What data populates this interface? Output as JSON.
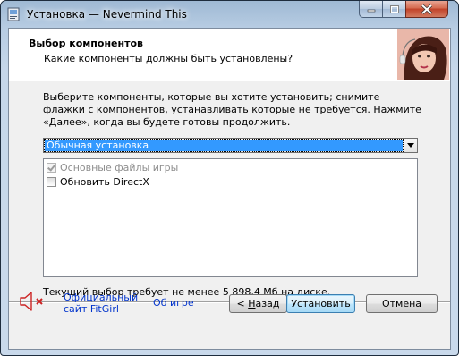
{
  "window": {
    "title": "Установка — Nevermind This"
  },
  "header": {
    "title": "Выбор компонентов",
    "subtitle": "Какие компоненты должны быть установлены?"
  },
  "main": {
    "description": "Выберите компоненты, которые вы хотите установить; снимите флажки с компонентов, устанавливать которые не требуется. Нажмите «Далее», когда вы будете готовы продолжить.",
    "install_type": {
      "selected": "Обычная установка"
    },
    "components": [
      {
        "label": "Основные файлы игры",
        "checked": true,
        "disabled": true
      },
      {
        "label": "Обновить DirectX",
        "checked": false,
        "disabled": false
      }
    ],
    "space_required": "Текущий выбор требует не менее 5 898,4 Мб на диске."
  },
  "footer": {
    "speaker_icon": "speaker-muted-icon",
    "link_site": "Официальный сайт FitGirl",
    "link_about": "Об игре",
    "back_prefix": "< ",
    "back_mnemonic": "Н",
    "back_rest": "азад",
    "install_label": "Установить",
    "cancel_label": "Отмена"
  },
  "colors": {
    "link": "#0033cc",
    "selection": "#3399ff",
    "mute_x": "#cc2222"
  }
}
